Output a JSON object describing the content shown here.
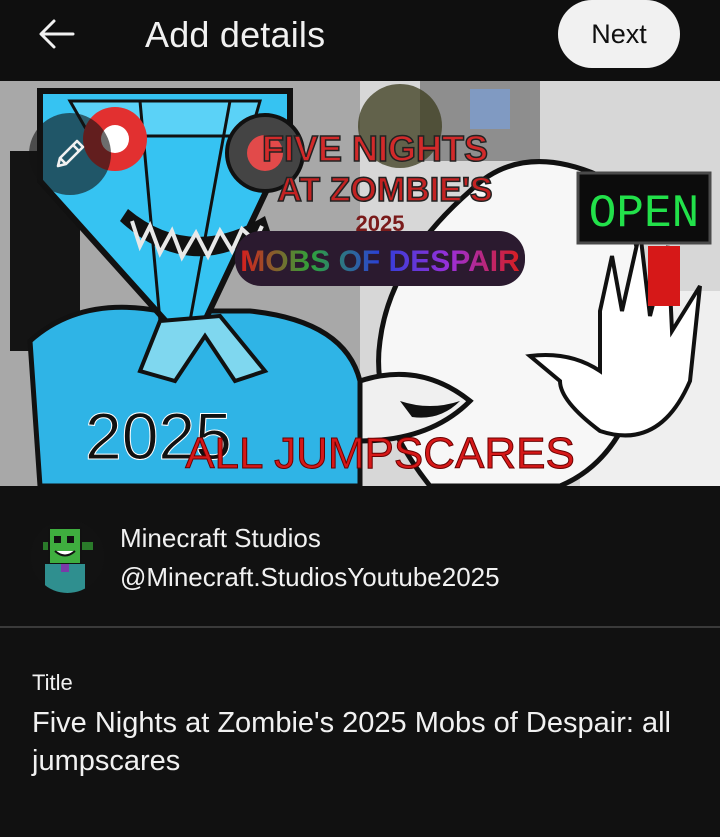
{
  "header": {
    "title": "Add details",
    "next_label": "Next",
    "back_icon": "arrow-left-icon"
  },
  "thumbnail": {
    "edit_icon": "pencil-icon",
    "text": {
      "line1": "FIVE NIGHTS",
      "line2": "AT ZOMBIE'S",
      "year": "2025",
      "subtitle": "MOBS OF DESPAIR",
      "open_sign": "OPEN",
      "chest_year": "2025",
      "banner": "ALL JUMPSCARES"
    },
    "colors": {
      "diamond": "#2fb4e6",
      "banner_red": "#d61818",
      "open_green": "#22e14a"
    }
  },
  "channel": {
    "name": "Minecraft Studios",
    "handle": "@Minecraft.StudiosYoutube2025"
  },
  "title_field": {
    "label": "Title",
    "value": "Five Nights at Zombie's 2025 Mobs of Despair: all jumpscares"
  }
}
